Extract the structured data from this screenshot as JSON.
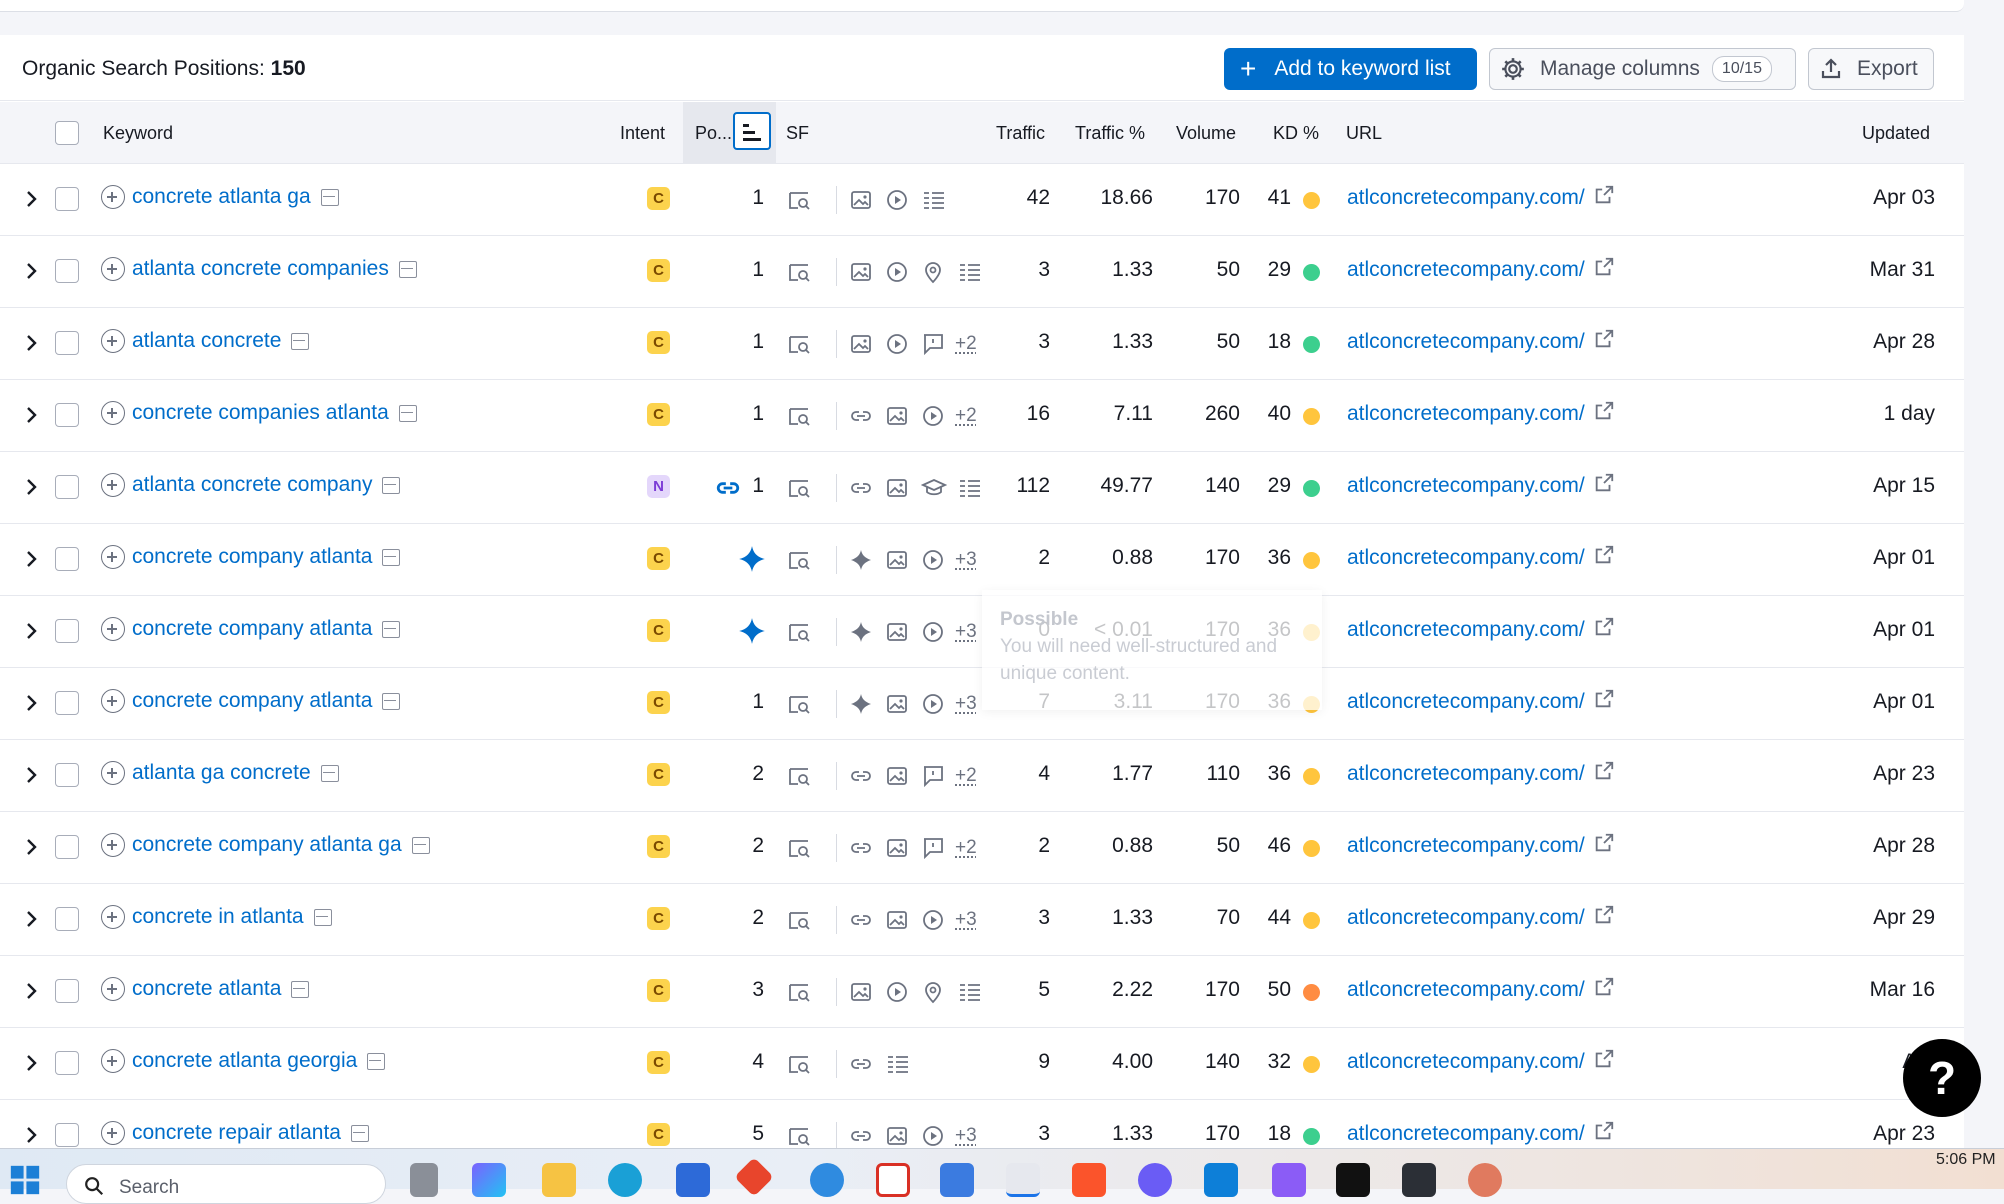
{
  "header": {
    "title_label": "Organic Search Positions:",
    "title_count": "150",
    "add_button": "Add to keyword list",
    "manage_button": "Manage columns",
    "manage_count": "10/15",
    "export_button": "Export"
  },
  "columns": {
    "keyword": "Keyword",
    "intent": "Intent",
    "position": "Po...",
    "sf": "SF",
    "traffic": "Traffic",
    "traffic_pct": "Traffic %",
    "volume": "Volume",
    "kd": "KD %",
    "url": "URL",
    "updated": "Updated"
  },
  "colors": {
    "accent": "#006dca",
    "kd_green": "#3ccf8e",
    "kd_yellow": "#ffc53d",
    "kd_orange": "#ff8c42"
  },
  "rows": [
    {
      "keyword": "concrete atlanta ga",
      "intent": "C",
      "position": "1",
      "position_icon": "",
      "sf": [
        "image",
        "video",
        "table"
      ],
      "more": "",
      "traffic": "42",
      "traffic_pct": "18.66",
      "volume": "170",
      "kd": "41",
      "kd_color": "yellow",
      "url": "atlconcretecompany.com/",
      "updated": "Apr 03"
    },
    {
      "keyword": "atlanta concrete companies",
      "intent": "C",
      "position": "1",
      "position_icon": "",
      "sf": [
        "image",
        "video",
        "pin",
        "table"
      ],
      "more": "",
      "traffic": "3",
      "traffic_pct": "1.33",
      "volume": "50",
      "kd": "29",
      "kd_color": "green",
      "url": "atlconcretecompany.com/",
      "updated": "Mar 31"
    },
    {
      "keyword": "atlanta concrete",
      "intent": "C",
      "position": "1",
      "position_icon": "",
      "sf": [
        "image",
        "video",
        "review"
      ],
      "more": "+2",
      "traffic": "3",
      "traffic_pct": "1.33",
      "volume": "50",
      "kd": "18",
      "kd_color": "green",
      "url": "atlconcretecompany.com/",
      "updated": "Apr 28"
    },
    {
      "keyword": "concrete companies atlanta",
      "intent": "C",
      "position": "1",
      "position_icon": "",
      "sf": [
        "link",
        "image",
        "video"
      ],
      "more": "+2",
      "traffic": "16",
      "traffic_pct": "7.11",
      "volume": "260",
      "kd": "40",
      "kd_color": "yellow",
      "url": "atlconcretecompany.com/",
      "updated": "1 day"
    },
    {
      "keyword": "atlanta concrete company",
      "intent": "N",
      "position": "1",
      "position_icon": "link",
      "sf": [
        "link",
        "image",
        "edu",
        "table"
      ],
      "more": "",
      "traffic": "112",
      "traffic_pct": "49.77",
      "volume": "140",
      "kd": "29",
      "kd_color": "green",
      "url": "atlconcretecompany.com/",
      "updated": "Apr 15"
    },
    {
      "keyword": "concrete company atlanta",
      "intent": "C",
      "position": "",
      "position_icon": "sparkle",
      "sf": [
        "sparkle",
        "image",
        "video"
      ],
      "more": "+3",
      "traffic": "2",
      "traffic_pct": "0.88",
      "volume": "170",
      "kd": "36",
      "kd_color": "yellow",
      "url": "atlconcretecompany.com/",
      "updated": "Apr 01"
    },
    {
      "keyword": "concrete company atlanta",
      "intent": "C",
      "position": "",
      "position_icon": "sparkle",
      "sf": [
        "sparkle",
        "image",
        "video"
      ],
      "more": "+3",
      "traffic": "0",
      "traffic_pct": "< 0.01",
      "volume": "170",
      "kd": "36",
      "kd_color": "yellow",
      "url": "atlconcretecompany.com/",
      "updated": "Apr 01"
    },
    {
      "keyword": "concrete company atlanta",
      "intent": "C",
      "position": "1",
      "position_icon": "",
      "sf": [
        "sparkle",
        "image",
        "video"
      ],
      "more": "+3",
      "traffic": "7",
      "traffic_pct": "3.11",
      "volume": "170",
      "kd": "36",
      "kd_color": "yellow",
      "url": "atlconcretecompany.com/",
      "updated": "Apr 01"
    },
    {
      "keyword": "atlanta ga concrete",
      "intent": "C",
      "position": "2",
      "position_icon": "",
      "sf": [
        "link",
        "image",
        "review"
      ],
      "more": "+2",
      "traffic": "4",
      "traffic_pct": "1.77",
      "volume": "110",
      "kd": "36",
      "kd_color": "yellow",
      "url": "atlconcretecompany.com/",
      "updated": "Apr 23"
    },
    {
      "keyword": "concrete company atlanta ga",
      "intent": "C",
      "position": "2",
      "position_icon": "",
      "sf": [
        "link",
        "image",
        "review"
      ],
      "more": "+2",
      "traffic": "2",
      "traffic_pct": "0.88",
      "volume": "50",
      "kd": "46",
      "kd_color": "yellow",
      "url": "atlconcretecompany.com/",
      "updated": "Apr 28"
    },
    {
      "keyword": "concrete in atlanta",
      "intent": "C",
      "position": "2",
      "position_icon": "",
      "sf": [
        "link",
        "image",
        "video"
      ],
      "more": "+3",
      "traffic": "3",
      "traffic_pct": "1.33",
      "volume": "70",
      "kd": "44",
      "kd_color": "yellow",
      "url": "atlconcretecompany.com/",
      "updated": "Apr 29"
    },
    {
      "keyword": "concrete atlanta",
      "intent": "C",
      "position": "3",
      "position_icon": "",
      "sf": [
        "image",
        "video",
        "pin",
        "table"
      ],
      "more": "",
      "traffic": "5",
      "traffic_pct": "2.22",
      "volume": "170",
      "kd": "50",
      "kd_color": "orange",
      "url": "atlconcretecompany.com/",
      "updated": "Mar 16"
    },
    {
      "keyword": "concrete atlanta georgia",
      "intent": "C",
      "position": "4",
      "position_icon": "",
      "sf": [
        "link",
        "table"
      ],
      "more": "",
      "traffic": "9",
      "traffic_pct": "4.00",
      "volume": "140",
      "kd": "32",
      "kd_color": "yellow",
      "url": "atlconcretecompany.com/",
      "updated": "Apr"
    },
    {
      "keyword": "concrete repair atlanta",
      "intent": "C",
      "position": "5",
      "position_icon": "",
      "sf": [
        "link",
        "image",
        "video"
      ],
      "more": "+3",
      "traffic": "3",
      "traffic_pct": "1.33",
      "volume": "170",
      "kd": "18",
      "kd_color": "green",
      "url": "atlconcretecompany.com/",
      "updated": "Apr 23"
    }
  ],
  "tooltip": {
    "title": "Possible",
    "text": "You will need well-structured and unique content."
  },
  "help_label": "?",
  "taskbar": {
    "search_placeholder": "Search",
    "time": "5:06 PM"
  }
}
